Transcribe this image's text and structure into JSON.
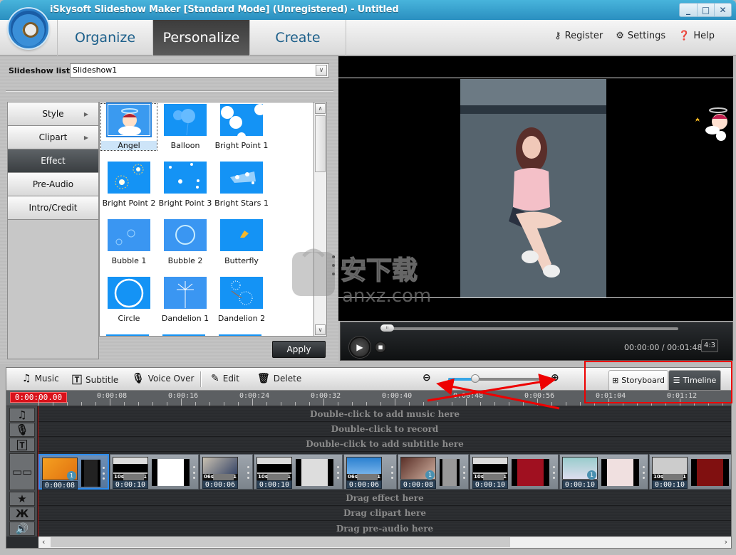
{
  "window": {
    "title": "iSkysoft Slideshow Maker [Standard Mode] (Unregistered) - Untitled",
    "controls": [
      "minimize",
      "maximize",
      "close"
    ]
  },
  "nav": {
    "tabs": [
      {
        "label": "Organize",
        "active": false
      },
      {
        "label": "Personalize",
        "active": true
      },
      {
        "label": "Create",
        "active": false
      }
    ],
    "right": [
      {
        "label": "Register",
        "icon": "key-icon"
      },
      {
        "label": "Settings",
        "icon": "gear-icon"
      },
      {
        "label": "Help",
        "icon": "help-icon"
      }
    ]
  },
  "slideshow_list": {
    "label": "Slideshow list :",
    "value": "Slideshow1"
  },
  "categories": [
    {
      "label": "Style",
      "has_submenu": true,
      "active": false
    },
    {
      "label": "Clipart",
      "has_submenu": true,
      "active": false
    },
    {
      "label": "Effect",
      "has_submenu": false,
      "active": true
    },
    {
      "label": "Pre-Audio",
      "has_submenu": false,
      "active": false
    },
    {
      "label": "Intro/Credit",
      "has_submenu": false,
      "active": false
    }
  ],
  "effects": [
    {
      "label": "Angel",
      "selected": true
    },
    {
      "label": "Balloon"
    },
    {
      "label": "Bright Point 1"
    },
    {
      "label": "Bright Point 2"
    },
    {
      "label": "Bright Point 3"
    },
    {
      "label": "Bright Stars 1"
    },
    {
      "label": "Bubble 1"
    },
    {
      "label": "Bubble 2"
    },
    {
      "label": "Butterfly"
    },
    {
      "label": "Circle"
    },
    {
      "label": "Dandelion 1"
    },
    {
      "label": "Dandelion 2"
    }
  ],
  "apply_label": "Apply",
  "player": {
    "current_time": "00:00:00",
    "total_time": "00:01:48",
    "time_display": "00:00:00 / 00:01:48",
    "aspect_ratio": "4:3",
    "progress": 0.0
  },
  "watermark": {
    "text_cn": "安下载",
    "text_en": "anxz.com"
  },
  "timeline_toolbar": {
    "buttons": [
      {
        "label": "Music",
        "icon": "music-note-icon"
      },
      {
        "label": "Subtitle",
        "icon": "subtitle-icon"
      },
      {
        "label": "Voice Over",
        "icon": "microphone-icon"
      },
      {
        "label": "Edit",
        "icon": "pencil-icon"
      },
      {
        "label": "Delete",
        "icon": "trash-icon"
      }
    ],
    "zoom_level": 0.3,
    "view_tabs": [
      {
        "label": "Storyboard",
        "icon": "grid-icon",
        "active": false
      },
      {
        "label": "Timeline",
        "icon": "list-icon",
        "active": true
      }
    ]
  },
  "ruler": {
    "current": "0:00:00.00",
    "ticks": [
      "0:00:08",
      "0:00:16",
      "0:00:24",
      "0:00:32",
      "0:00:40",
      "0:00:48",
      "0:00:56",
      "0:01:04",
      "0:01:12"
    ]
  },
  "tracks": {
    "music": "Double-click to add music here",
    "voice": "Double-click to record",
    "subtitle": "Double-click to add subtitle here",
    "effect": "Drag effect here",
    "clipart": "Drag clipart here",
    "preaudio": "Drag pre-audio here"
  },
  "clips": [
    {
      "duration": "0:00:08",
      "badge": "1",
      "tag": null,
      "selected": true
    },
    {
      "duration": "0:00:10",
      "badge": null,
      "tag": {
        "sec": "10s",
        "num": "1"
      }
    },
    {
      "duration": "0:00:06",
      "badge": null,
      "tag": {
        "sec": "06s",
        "num": "1"
      }
    },
    {
      "duration": "0:00:10",
      "badge": null,
      "tag": {
        "sec": "10s",
        "num": "1"
      }
    },
    {
      "duration": "0:00:06",
      "badge": null,
      "tag": {
        "sec": "06s",
        "num": "1"
      }
    },
    {
      "duration": "0:00:08",
      "badge": "1",
      "tag": null
    },
    {
      "duration": "0:00:10",
      "badge": null,
      "tag": {
        "sec": "10s",
        "num": "1"
      }
    },
    {
      "duration": "0:00:10",
      "badge": "1",
      "tag": null
    },
    {
      "duration": "0:00:10",
      "badge": null,
      "tag": {
        "sec": "10s",
        "num": "1"
      }
    }
  ],
  "colors": {
    "accent": "#2a8fc0",
    "playhead": "#d9111a",
    "annotation": "#ee0000",
    "effect_tile": "#1493f5"
  }
}
